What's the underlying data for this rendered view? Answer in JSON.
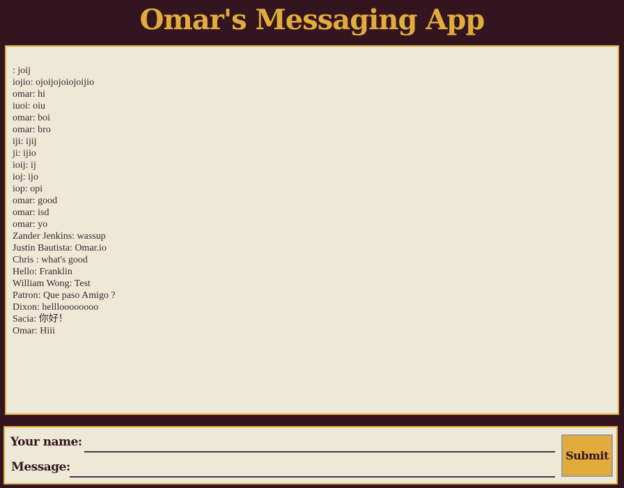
{
  "app": {
    "title": "Omar's Messaging App"
  },
  "messages": [
    ": joij",
    "iojio: ojoijojoiojoijio",
    "omar: hi",
    "iuoi: oiu",
    "omar: boi",
    "omar: bro",
    "iji: ijij",
    "ji: ijio",
    "ioij: ij",
    "ioj: ijo",
    "iop: opi",
    "omar: good",
    "omar: isd",
    "omar: yo",
    "Zander Jenkins: wassup",
    "Justin Bautista: Omar.io",
    "Chris : what's good",
    "Hello: Franklin",
    "William Wong: Test",
    "Patron: Que paso Amigo ?",
    "Dixon: hellloooooooo",
    "Sacia: 你好！",
    "Omar: Hiii"
  ],
  "form": {
    "name_label": "Your name:",
    "name_value": "",
    "message_label": "Message:",
    "message_value": "",
    "submit_label": "Submit"
  },
  "colors": {
    "background": "#331520",
    "accent": "#e1ac3b",
    "panel": "#ede9d6"
  }
}
